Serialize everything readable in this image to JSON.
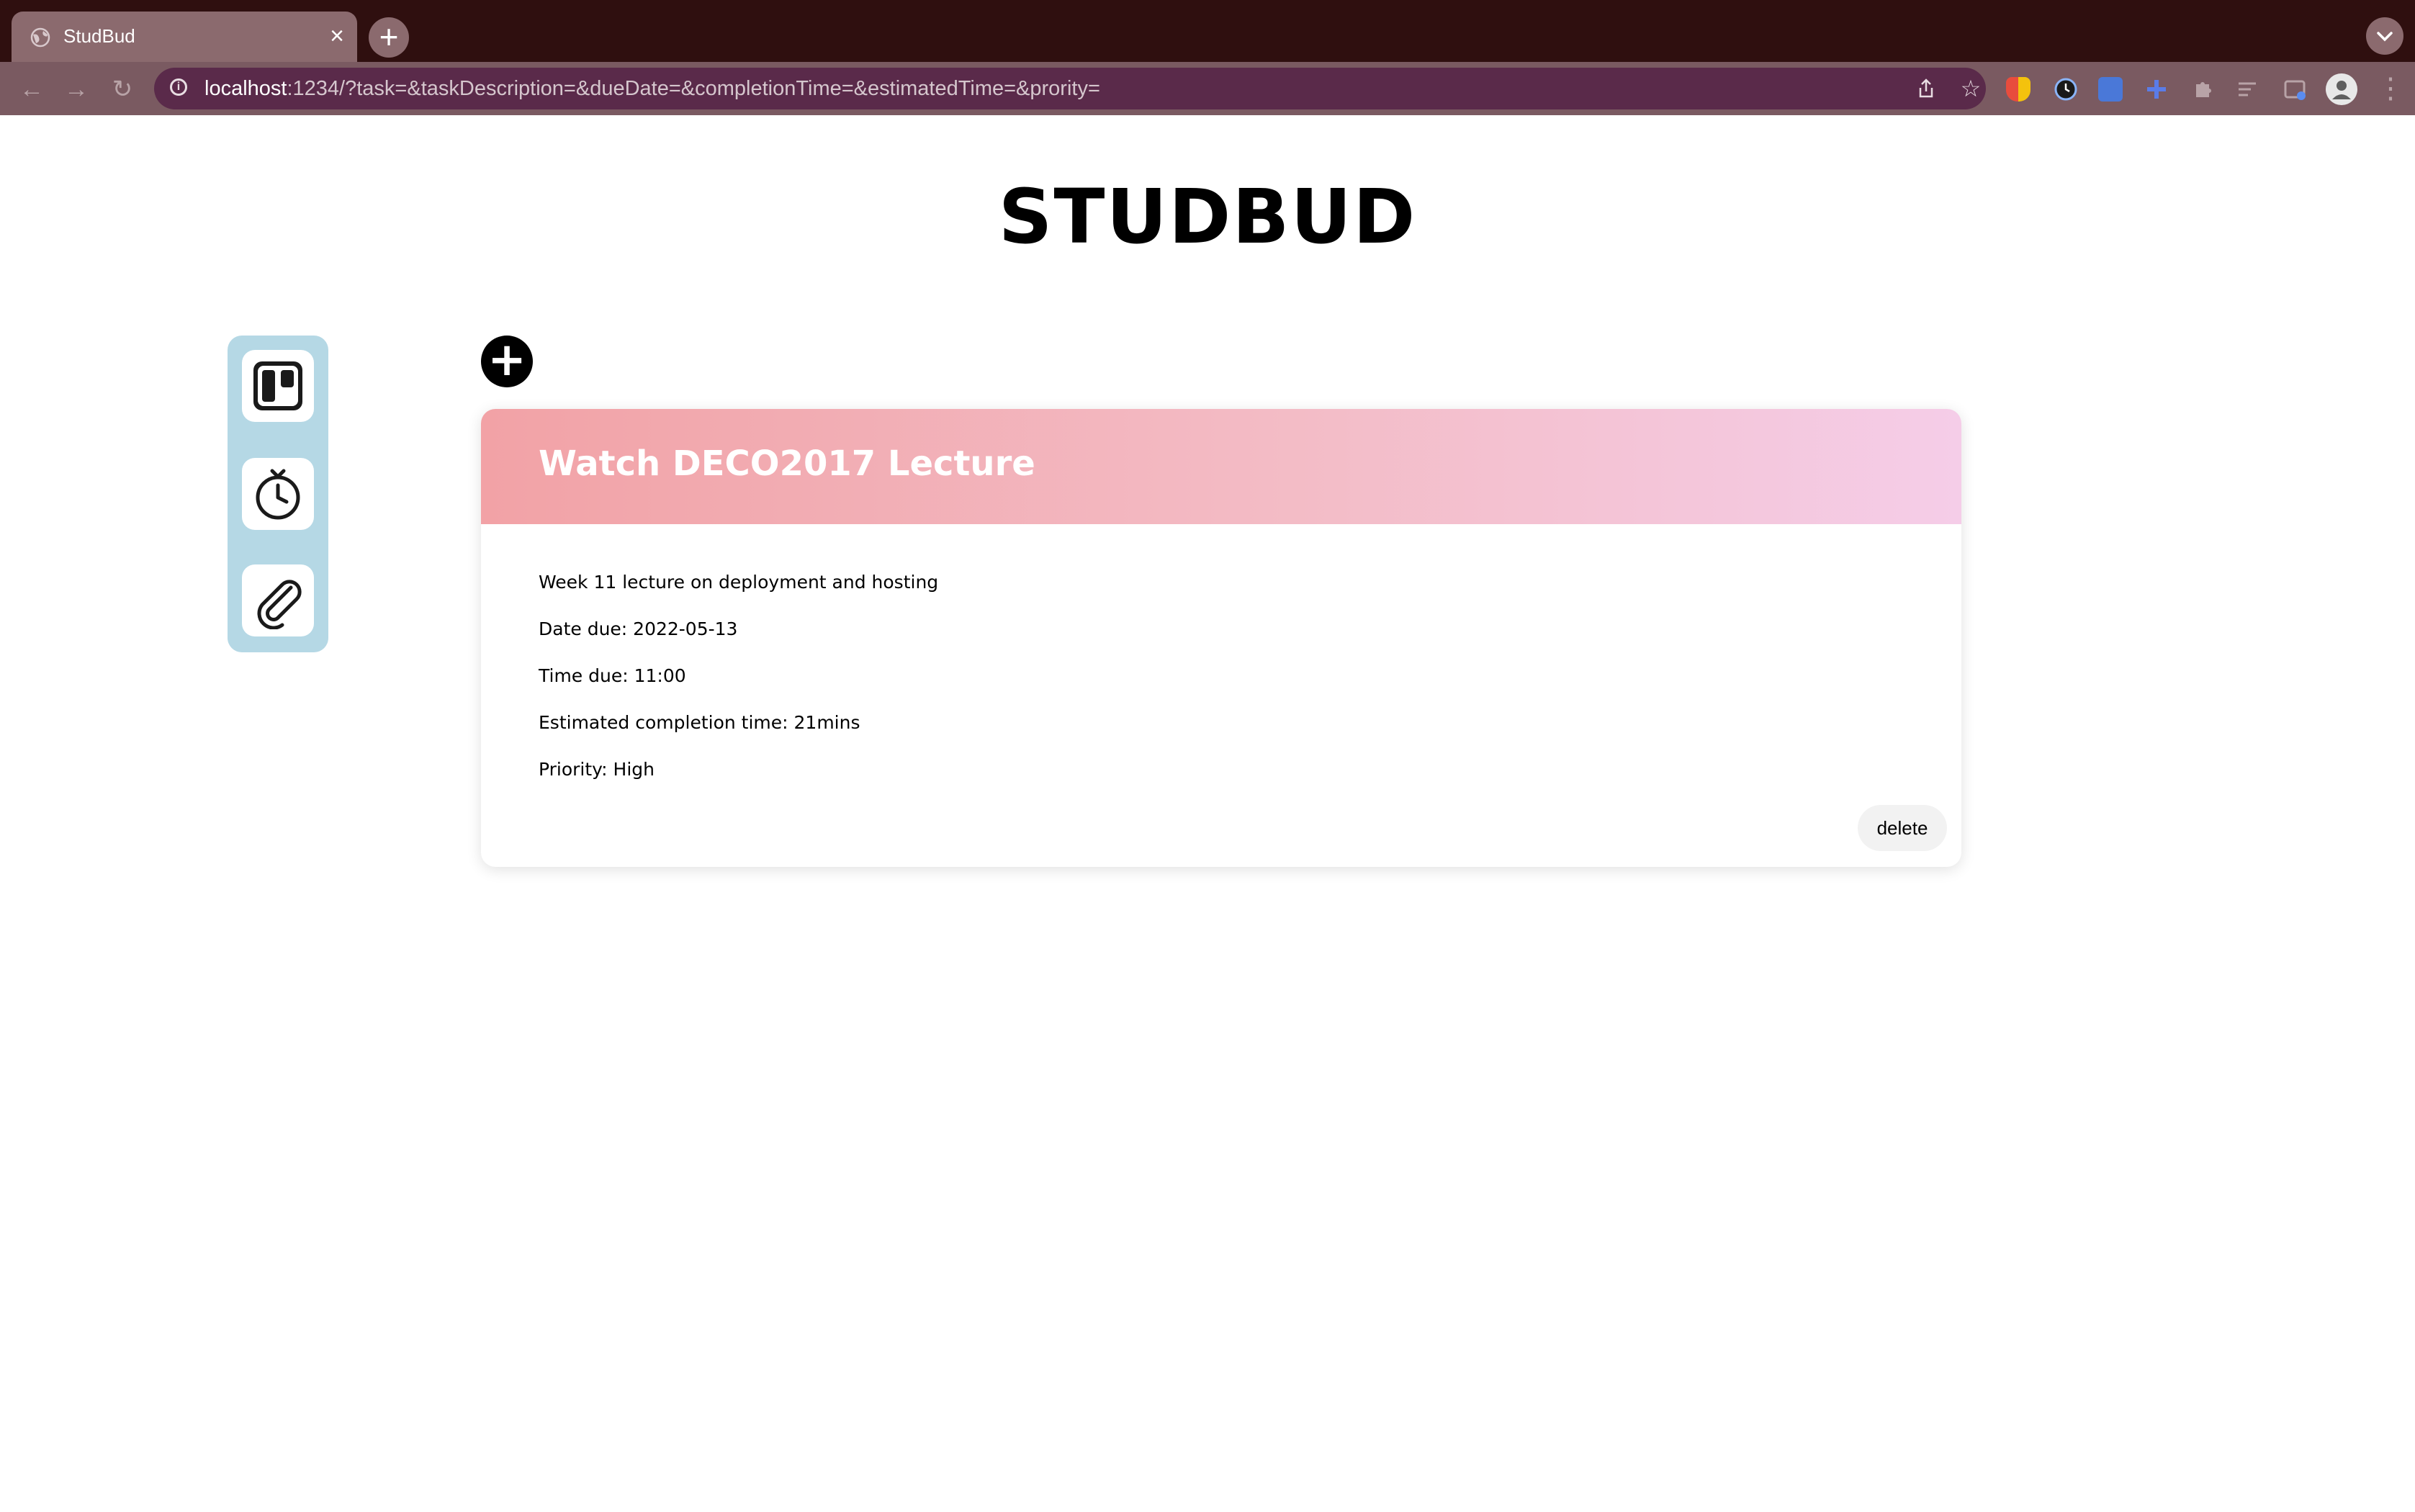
{
  "browser": {
    "tab_title": "StudBud",
    "tab_close": "×",
    "new_tab": "+",
    "url_host": "localhost",
    "url_rest": ":1234/?task=&taskDescription=&dueDate=&completionTime=&estimatedTime=&prority="
  },
  "page": {
    "title": "STUDBUD",
    "add_label": "+"
  },
  "task": {
    "title": "Watch DECO2017 Lecture",
    "description": "Week 11 lecture on deployment and hosting",
    "date_due": "Date due: 2022-05-13",
    "time_due": "Time due: 11:00",
    "estimated": "Estimated completion time: 21mins",
    "priority": "Priority: High",
    "delete_label": "delete"
  },
  "sidebar": {
    "items": [
      {
        "icon": "kanban-board-icon"
      },
      {
        "icon": "stopwatch-icon"
      },
      {
        "icon": "paperclip-icon"
      }
    ]
  },
  "colors": {
    "sidebar_bg": "#b5d8e5",
    "header_gradient_start": "#f2a2a6",
    "header_gradient_end": "#f5cde8",
    "tabbar_bg": "#2f0f0f"
  }
}
